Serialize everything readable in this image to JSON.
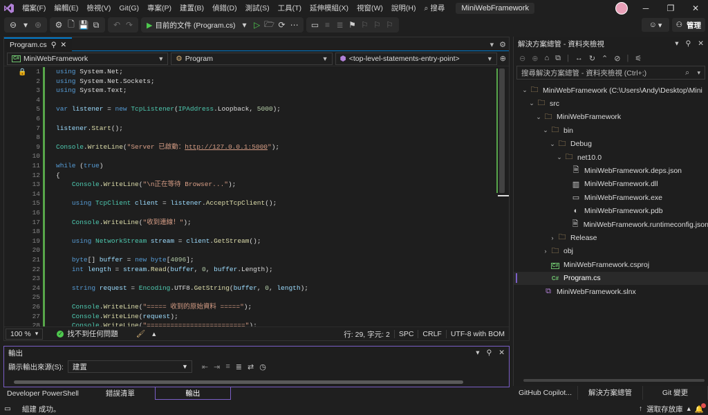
{
  "menubar": {
    "items": [
      "檔案(F)",
      "編輯(E)",
      "檢視(V)",
      "Git(G)",
      "專案(P)",
      "建置(B)",
      "偵錯(D)",
      "測試(S)",
      "工具(T)",
      "延伸模組(X)",
      "視窗(W)",
      "說明(H)"
    ],
    "search_label": "搜尋",
    "solution_name": "MiniWebFramework"
  },
  "toolbar": {
    "run_target": "目前的文件 (Program.cs)",
    "manage_label": "管理"
  },
  "editor": {
    "tab_label": "Program.cs",
    "nav_project": "MiniWebFramework",
    "nav_class": "Program",
    "nav_member": "<top-level-statements-entry-point>",
    "line_numbers": [
      "1",
      "2",
      "3",
      "4",
      "5",
      "6",
      "7",
      "8",
      "9",
      "10",
      "11",
      "12",
      "13",
      "14",
      "15",
      "16",
      "17",
      "18",
      "19",
      "20",
      "21",
      "22",
      "23",
      "24",
      "25",
      "26",
      "27",
      "28"
    ],
    "zoom": "100 %",
    "issues": "找不到任何問題",
    "position": "行: 29, 字元: 2",
    "spacing": "SPC",
    "line_ending": "CRLF",
    "encoding": "UTF-8 with BOM"
  },
  "output": {
    "title": "輸出",
    "source_label": "顯示輸出來源(S):",
    "source_value": "建置"
  },
  "bottom_tabs": [
    "Developer PowerShell",
    "錯誤清單",
    "輸出"
  ],
  "solution_explorer": {
    "title": "解決方案總管 - 資料夾檢視",
    "search_placeholder": "搜尋解決方案總管 - 資料夾檢視 (Ctrl+;)",
    "tree": [
      {
        "label": "MiniWebFramework (C:\\Users\\Andy\\Desktop\\Mini",
        "depth": 0,
        "arrow": "open",
        "kind": "folder"
      },
      {
        "label": "src",
        "depth": 1,
        "arrow": "open",
        "kind": "folder"
      },
      {
        "label": "MiniWebFramework",
        "depth": 2,
        "arrow": "open",
        "kind": "folder"
      },
      {
        "label": "bin",
        "depth": 3,
        "arrow": "open",
        "kind": "folder"
      },
      {
        "label": "Debug",
        "depth": 4,
        "arrow": "open",
        "kind": "folder"
      },
      {
        "label": "net10.0",
        "depth": 5,
        "arrow": "open",
        "kind": "folder"
      },
      {
        "label": "MiniWebFramework.deps.json",
        "depth": 6,
        "arrow": "",
        "kind": "json"
      },
      {
        "label": "MiniWebFramework.dll",
        "depth": 6,
        "arrow": "",
        "kind": "dll"
      },
      {
        "label": "MiniWebFramework.exe",
        "depth": 6,
        "arrow": "",
        "kind": "exe"
      },
      {
        "label": "MiniWebFramework.pdb",
        "depth": 6,
        "arrow": "",
        "kind": "pdb"
      },
      {
        "label": "MiniWebFramework.runtimeconfig.json",
        "depth": 6,
        "arrow": "",
        "kind": "json"
      },
      {
        "label": "Release",
        "depth": 4,
        "arrow": "closed",
        "kind": "folder"
      },
      {
        "label": "obj",
        "depth": 3,
        "arrow": "closed",
        "kind": "folder"
      },
      {
        "label": "MiniWebFramework.csproj",
        "depth": 3,
        "arrow": "",
        "kind": "csproj"
      },
      {
        "label": "Program.cs",
        "depth": 3,
        "arrow": "",
        "kind": "cs",
        "selected": true
      },
      {
        "label": "MiniWebFramework.slnx",
        "depth": 2,
        "arrow": "",
        "kind": "sln"
      }
    ],
    "tabs": [
      "GitHub Copilot...",
      "解決方案總管",
      "Git 變更"
    ]
  },
  "statusbar": {
    "message": "組建 成功。",
    "source_control": "選取存放庫"
  }
}
